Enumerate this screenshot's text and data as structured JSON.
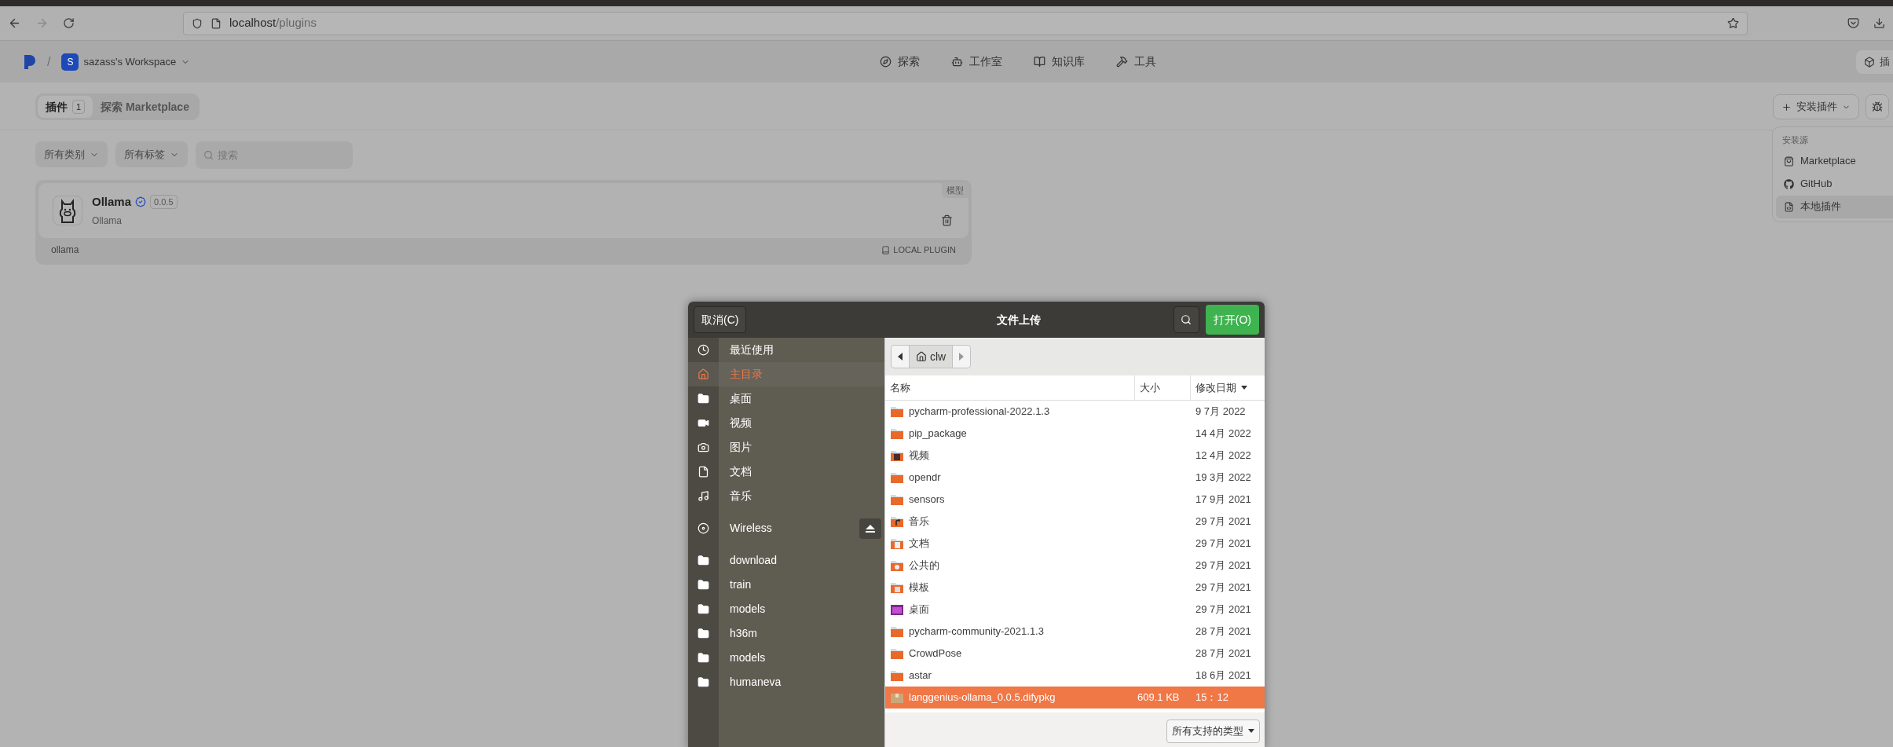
{
  "browser": {
    "url_host": "localhost",
    "url_path": "/plugins"
  },
  "header": {
    "separator": "/",
    "workspace_initial": "S",
    "workspace": "sazass's Workspace",
    "nav": [
      {
        "label": "探索",
        "kind": "compass"
      },
      {
        "label": "工作室",
        "kind": "robot"
      },
      {
        "label": "知识库",
        "kind": "book"
      },
      {
        "label": "工具",
        "kind": "hammer"
      }
    ],
    "right_button": "插"
  },
  "tabs": [
    {
      "label": "插件",
      "badge": "1",
      "selected": true
    },
    {
      "label": "探索 Marketplace",
      "selected": false
    }
  ],
  "filters": [
    "所有类别",
    "所有标签"
  ],
  "search": {
    "placeholder": "搜索"
  },
  "plugin": {
    "name": "Ollama",
    "verified": true,
    "version": "0.0.5",
    "org": "Ollama",
    "category": "模型",
    "id": "ollama",
    "source": "LOCAL PLUGIN"
  },
  "install_button": "安装插件",
  "install_menu": {
    "heading": "安装源",
    "items": [
      {
        "label": "Marketplace",
        "kind": "bag",
        "selected": false
      },
      {
        "label": "GitHub",
        "kind": "github",
        "selected": false
      },
      {
        "label": "本地插件",
        "kind": "file",
        "selected": true
      }
    ]
  },
  "dialog": {
    "cancel": "取消(C)",
    "title": "文件上传",
    "open": "打开(O)",
    "path": "clw",
    "places": [
      {
        "label": "最近使用",
        "kind": "recent",
        "selected": false
      },
      {
        "label": "主目录",
        "kind": "home",
        "selected": true
      },
      {
        "label": "桌面",
        "kind": "folder",
        "selected": false
      },
      {
        "label": "视频",
        "kind": "video",
        "selected": false
      },
      {
        "label": "图片",
        "kind": "camera",
        "selected": false
      },
      {
        "label": "文档",
        "kind": "document",
        "selected": false
      },
      {
        "label": "音乐",
        "kind": "music",
        "selected": false
      },
      {
        "label": "Wireless",
        "kind": "drive",
        "selected": false,
        "eject": true
      },
      {
        "label": "download",
        "kind": "folder",
        "selected": false
      },
      {
        "label": "train",
        "kind": "folder",
        "selected": false
      },
      {
        "label": "models",
        "kind": "folder",
        "selected": false
      },
      {
        "label": "h36m",
        "kind": "folder",
        "selected": false
      },
      {
        "label": "models",
        "kind": "folder",
        "selected": false
      },
      {
        "label": "humaneva",
        "kind": "folder",
        "selected": false
      }
    ],
    "columns": [
      "名称",
      "大小",
      "修改日期"
    ],
    "files": [
      {
        "name": "pycharm-professional-2022.1.3",
        "modified": "9 7月 2022",
        "kind": "folder",
        "selected": false
      },
      {
        "name": "pip_package",
        "modified": "14 4月 2022",
        "kind": "folder",
        "selected": false
      },
      {
        "name": "视频",
        "modified": "12 4月 2022",
        "kind": "video",
        "selected": false
      },
      {
        "name": "opendr",
        "modified": "19 3月 2022",
        "kind": "folder",
        "selected": false
      },
      {
        "name": "sensors",
        "modified": "17 9月 2021",
        "kind": "folder",
        "selected": false
      },
      {
        "name": "音乐",
        "modified": "29 7月 2021",
        "kind": "music",
        "selected": false
      },
      {
        "name": "文档",
        "modified": "29 7月 2021",
        "kind": "documents",
        "selected": false
      },
      {
        "name": "公共的",
        "modified": "29 7月 2021",
        "kind": "public",
        "selected": false
      },
      {
        "name": "模板",
        "modified": "29 7月 2021",
        "kind": "templates",
        "selected": false
      },
      {
        "name": "桌面",
        "modified": "29 7月 2021",
        "kind": "desktop",
        "selected": false
      },
      {
        "name": "pycharm-community-2021.1.3",
        "modified": "28 7月 2021",
        "kind": "folder",
        "selected": false
      },
      {
        "name": "CrowdPose",
        "modified": "28 7月 2021",
        "kind": "folder",
        "selected": false
      },
      {
        "name": "astar",
        "modified": "18 6月 2021",
        "kind": "folder",
        "selected": false
      },
      {
        "name": "langgenius-ollama_0.0.5.difypkg",
        "size": "609.1 KB",
        "modified": "15：12",
        "kind": "package",
        "selected": true
      }
    ],
    "filter": "所有支持的类型"
  }
}
